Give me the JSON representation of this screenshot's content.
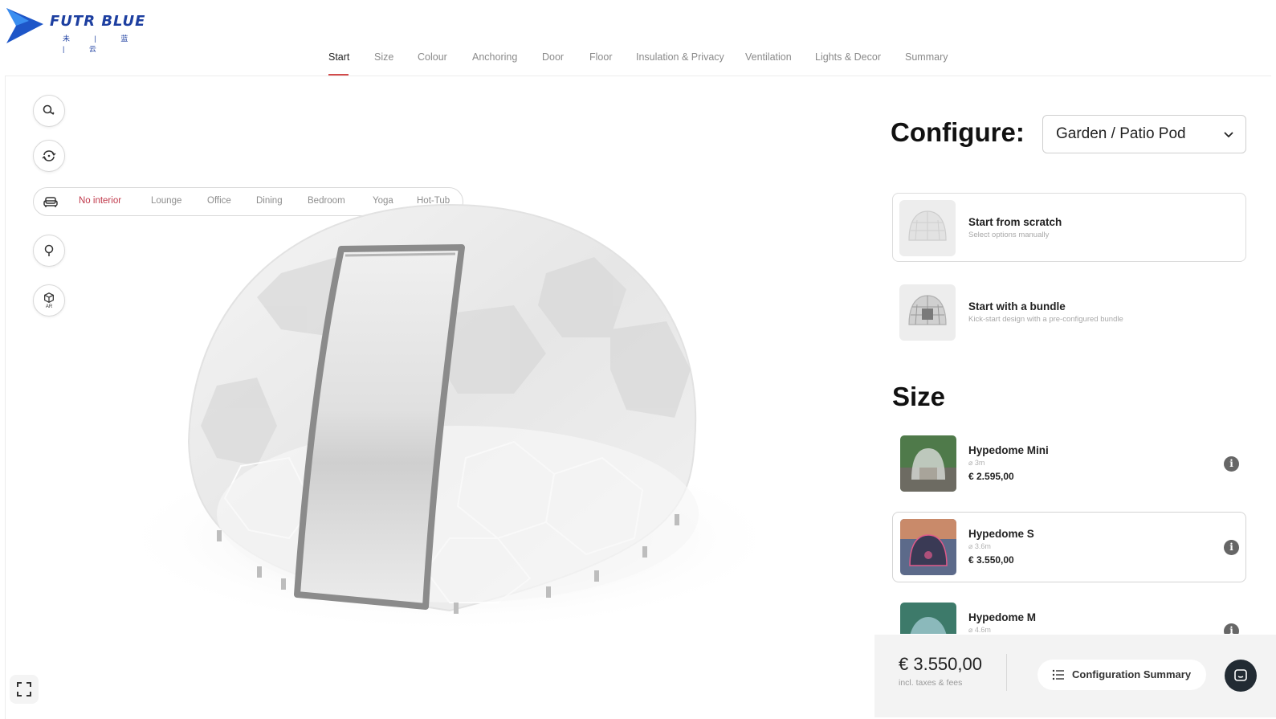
{
  "logo": {
    "brand": "FUTR BLUE",
    "sub": "未 | 蓝 | 云",
    "icon": "arrow-logo-icon"
  },
  "nav": {
    "tabs": [
      {
        "label": "Start",
        "active": true
      },
      {
        "label": "Size"
      },
      {
        "label": "Colour"
      },
      {
        "label": "Anchoring"
      },
      {
        "label": "Door"
      },
      {
        "label": "Floor"
      },
      {
        "label": "Insulation & Privacy"
      },
      {
        "label": "Ventilation"
      },
      {
        "label": "Lights & Decor"
      },
      {
        "label": "Summary"
      }
    ]
  },
  "tools": {
    "zoom_icon": "zoom-icon",
    "rotate_icon": "rotate-icon",
    "tree_icon": "tree-icon",
    "ar_icon": "cube-ar-icon",
    "ar_label": "AR"
  },
  "interior": {
    "icon": "sofa-icon",
    "options": [
      "No interior",
      "Lounge",
      "Office",
      "Dining",
      "Bedroom",
      "Yoga",
      "Hot-Tub"
    ],
    "active": "No interior"
  },
  "config": {
    "title": "Configure:",
    "select_value": "Garden / Patio Pod",
    "options": [
      {
        "title": "Start from scratch",
        "sub": "Select options manually"
      },
      {
        "title": "Start with a bundle",
        "sub": "Kick-start design with a pre-configured bundle"
      }
    ]
  },
  "size": {
    "title": "Size",
    "items": [
      {
        "name": "Hypedome Mini",
        "dia": "⌀ 3m",
        "price": "€ 2.595,00",
        "selected": false
      },
      {
        "name": "Hypedome S",
        "dia": "⌀ 3.6m",
        "price": "€ 3.550,00",
        "selected": true
      },
      {
        "name": "Hypedome M",
        "dia": "⌀ 4.6m",
        "price": "",
        "selected": false
      }
    ]
  },
  "footer": {
    "total": "€ 3.550,00",
    "note": "incl. taxes & fees",
    "summary_label": "Configuration  Summary",
    "summary_icon": "list-icon",
    "chat_icon": "chat-icon"
  },
  "colors": {
    "accent": "#c0394b",
    "brand": "#1d3fa0",
    "dark": "#222b33"
  }
}
